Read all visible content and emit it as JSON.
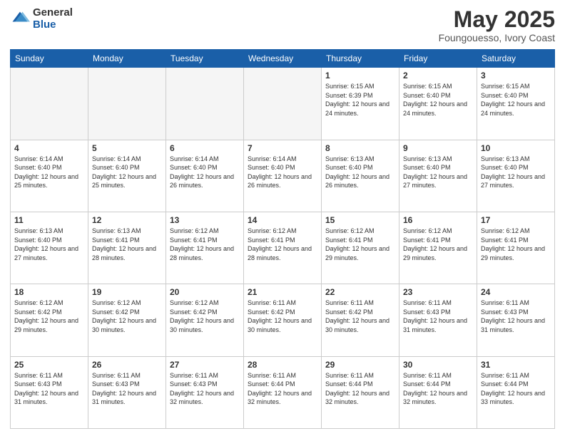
{
  "logo": {
    "general": "General",
    "blue": "Blue"
  },
  "header": {
    "title": "May 2025",
    "subtitle": "Foungouesso, Ivory Coast"
  },
  "days_of_week": [
    "Sunday",
    "Monday",
    "Tuesday",
    "Wednesday",
    "Thursday",
    "Friday",
    "Saturday"
  ],
  "weeks": [
    [
      {
        "day": "",
        "info": ""
      },
      {
        "day": "",
        "info": ""
      },
      {
        "day": "",
        "info": ""
      },
      {
        "day": "",
        "info": ""
      },
      {
        "day": "1",
        "info": "Sunrise: 6:15 AM\nSunset: 6:39 PM\nDaylight: 12 hours and 24 minutes."
      },
      {
        "day": "2",
        "info": "Sunrise: 6:15 AM\nSunset: 6:40 PM\nDaylight: 12 hours and 24 minutes."
      },
      {
        "day": "3",
        "info": "Sunrise: 6:15 AM\nSunset: 6:40 PM\nDaylight: 12 hours and 24 minutes."
      }
    ],
    [
      {
        "day": "4",
        "info": "Sunrise: 6:14 AM\nSunset: 6:40 PM\nDaylight: 12 hours and 25 minutes."
      },
      {
        "day": "5",
        "info": "Sunrise: 6:14 AM\nSunset: 6:40 PM\nDaylight: 12 hours and 25 minutes."
      },
      {
        "day": "6",
        "info": "Sunrise: 6:14 AM\nSunset: 6:40 PM\nDaylight: 12 hours and 26 minutes."
      },
      {
        "day": "7",
        "info": "Sunrise: 6:14 AM\nSunset: 6:40 PM\nDaylight: 12 hours and 26 minutes."
      },
      {
        "day": "8",
        "info": "Sunrise: 6:13 AM\nSunset: 6:40 PM\nDaylight: 12 hours and 26 minutes."
      },
      {
        "day": "9",
        "info": "Sunrise: 6:13 AM\nSunset: 6:40 PM\nDaylight: 12 hours and 27 minutes."
      },
      {
        "day": "10",
        "info": "Sunrise: 6:13 AM\nSunset: 6:40 PM\nDaylight: 12 hours and 27 minutes."
      }
    ],
    [
      {
        "day": "11",
        "info": "Sunrise: 6:13 AM\nSunset: 6:40 PM\nDaylight: 12 hours and 27 minutes."
      },
      {
        "day": "12",
        "info": "Sunrise: 6:13 AM\nSunset: 6:41 PM\nDaylight: 12 hours and 28 minutes."
      },
      {
        "day": "13",
        "info": "Sunrise: 6:12 AM\nSunset: 6:41 PM\nDaylight: 12 hours and 28 minutes."
      },
      {
        "day": "14",
        "info": "Sunrise: 6:12 AM\nSunset: 6:41 PM\nDaylight: 12 hours and 28 minutes."
      },
      {
        "day": "15",
        "info": "Sunrise: 6:12 AM\nSunset: 6:41 PM\nDaylight: 12 hours and 29 minutes."
      },
      {
        "day": "16",
        "info": "Sunrise: 6:12 AM\nSunset: 6:41 PM\nDaylight: 12 hours and 29 minutes."
      },
      {
        "day": "17",
        "info": "Sunrise: 6:12 AM\nSunset: 6:41 PM\nDaylight: 12 hours and 29 minutes."
      }
    ],
    [
      {
        "day": "18",
        "info": "Sunrise: 6:12 AM\nSunset: 6:42 PM\nDaylight: 12 hours and 29 minutes."
      },
      {
        "day": "19",
        "info": "Sunrise: 6:12 AM\nSunset: 6:42 PM\nDaylight: 12 hours and 30 minutes."
      },
      {
        "day": "20",
        "info": "Sunrise: 6:12 AM\nSunset: 6:42 PM\nDaylight: 12 hours and 30 minutes."
      },
      {
        "day": "21",
        "info": "Sunrise: 6:11 AM\nSunset: 6:42 PM\nDaylight: 12 hours and 30 minutes."
      },
      {
        "day": "22",
        "info": "Sunrise: 6:11 AM\nSunset: 6:42 PM\nDaylight: 12 hours and 30 minutes."
      },
      {
        "day": "23",
        "info": "Sunrise: 6:11 AM\nSunset: 6:43 PM\nDaylight: 12 hours and 31 minutes."
      },
      {
        "day": "24",
        "info": "Sunrise: 6:11 AM\nSunset: 6:43 PM\nDaylight: 12 hours and 31 minutes."
      }
    ],
    [
      {
        "day": "25",
        "info": "Sunrise: 6:11 AM\nSunset: 6:43 PM\nDaylight: 12 hours and 31 minutes."
      },
      {
        "day": "26",
        "info": "Sunrise: 6:11 AM\nSunset: 6:43 PM\nDaylight: 12 hours and 31 minutes."
      },
      {
        "day": "27",
        "info": "Sunrise: 6:11 AM\nSunset: 6:43 PM\nDaylight: 12 hours and 32 minutes."
      },
      {
        "day": "28",
        "info": "Sunrise: 6:11 AM\nSunset: 6:44 PM\nDaylight: 12 hours and 32 minutes."
      },
      {
        "day": "29",
        "info": "Sunrise: 6:11 AM\nSunset: 6:44 PM\nDaylight: 12 hours and 32 minutes."
      },
      {
        "day": "30",
        "info": "Sunrise: 6:11 AM\nSunset: 6:44 PM\nDaylight: 12 hours and 32 minutes."
      },
      {
        "day": "31",
        "info": "Sunrise: 6:11 AM\nSunset: 6:44 PM\nDaylight: 12 hours and 33 minutes."
      }
    ]
  ]
}
